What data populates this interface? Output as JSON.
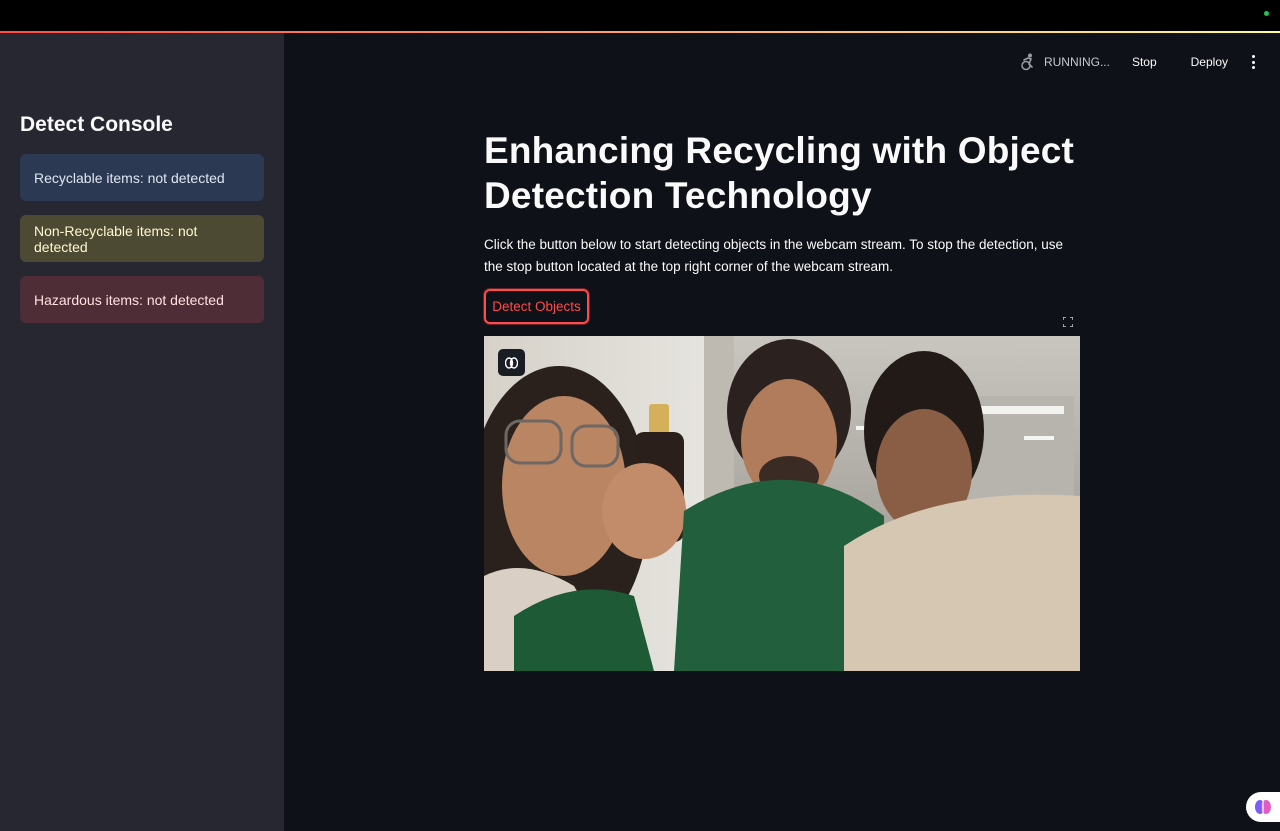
{
  "toolbar": {
    "running_label": "RUNNING...",
    "stop_label": "Stop",
    "deploy_label": "Deploy",
    "running_icon": "running-figure-icon",
    "menu_icon": "kebab-menu-icon"
  },
  "sidebar": {
    "title": "Detect Console",
    "alerts": [
      {
        "label": "Recyclable items: not detected",
        "kind": "info"
      },
      {
        "label": "Non-Recyclable items: not detected",
        "kind": "warning"
      },
      {
        "label": "Hazardous items: not detected",
        "kind": "error"
      }
    ]
  },
  "main": {
    "title": "Enhancing Recycling with Object Detection Technology",
    "description": "Click the button below to start detecting objects in the webcam stream. To stop the detection, use the stop button located at the top right corner of the webcam stream.",
    "detect_button_label": "Detect Objects",
    "fullscreen_icon": "fullscreen-icon",
    "stream_badge_icon": "brain-icon"
  },
  "colors": {
    "app_background": "#0e1117",
    "sidebar_background": "#262730",
    "accent": "#ff4b4b",
    "info_background": "#2b3a52",
    "warning_background": "#4d4a33",
    "error_background": "#4f2d37",
    "status_dot": "#21c354"
  },
  "assistant_icon": "brain-assistant-icon"
}
